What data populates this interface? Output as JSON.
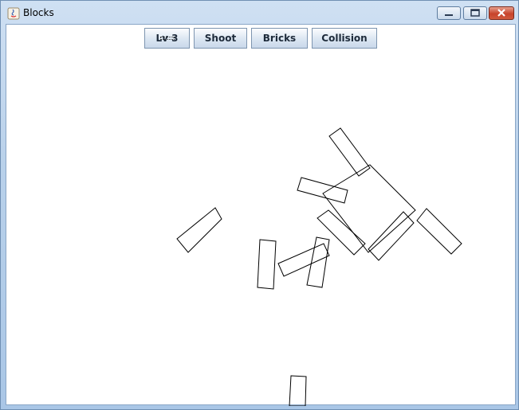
{
  "window": {
    "title": "Blocks"
  },
  "toolbar": {
    "buttons": [
      {
        "label": "Lv 3"
      },
      {
        "label": "Shoot"
      },
      {
        "label": "Bricks"
      },
      {
        "label": "Collision"
      }
    ]
  },
  "colors": {
    "block_stroke": "#000000",
    "background": "#ffffff"
  }
}
